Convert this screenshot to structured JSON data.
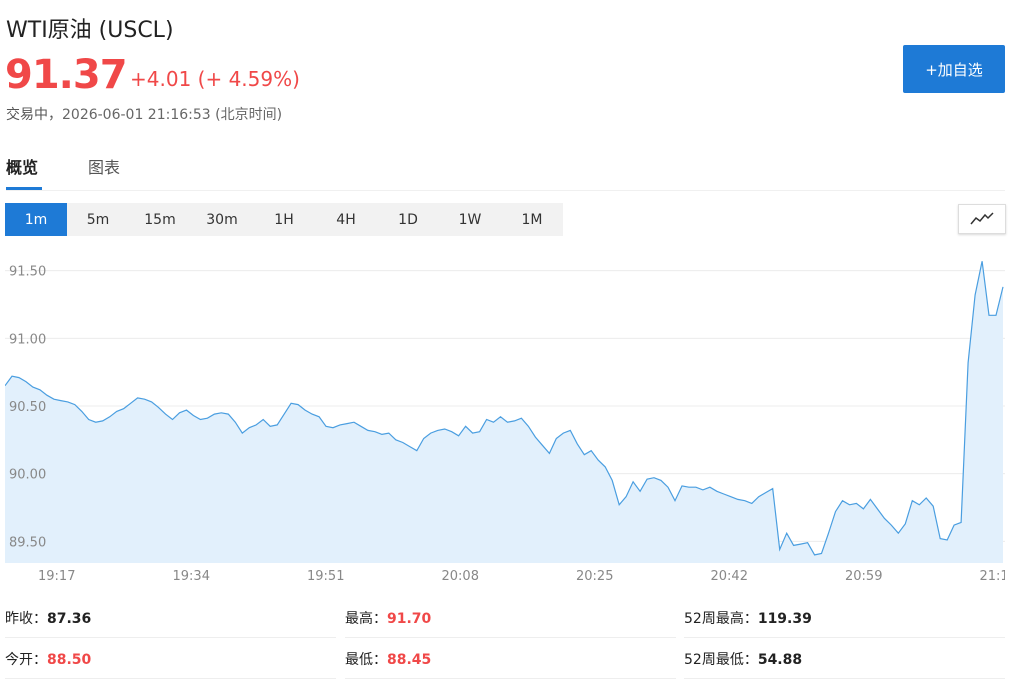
{
  "header": {
    "title": "WTI原油 (USCL)",
    "price": "91.37",
    "change": "+4.01 (+ 4.59%)",
    "status": "交易中，",
    "timestamp": "2026-06-01 21:16:53 (北京时间)",
    "add_button": "+加自选"
  },
  "tabs": [
    {
      "label": "概览",
      "active": true
    },
    {
      "label": "图表",
      "active": false
    }
  ],
  "intervals": [
    {
      "label": "1m",
      "active": true
    },
    {
      "label": "5m",
      "active": false
    },
    {
      "label": "15m",
      "active": false
    },
    {
      "label": "30m",
      "active": false
    },
    {
      "label": "1H",
      "active": false
    },
    {
      "label": "4H",
      "active": false
    },
    {
      "label": "1D",
      "active": false
    },
    {
      "label": "1W",
      "active": false
    },
    {
      "label": "1M",
      "active": false
    }
  ],
  "chart_toggle_icon": "line-chart-icon",
  "colors": {
    "accent": "#1e7ad6",
    "up": "#f04848",
    "line": "#4a9ee0",
    "fill": "#e2f0fc"
  },
  "chart_data": {
    "type": "area",
    "y_ticks": [
      "91.50",
      "91.00",
      "90.50",
      "90.00",
      "89.50"
    ],
    "x_ticks": [
      "19:17",
      "19:34",
      "19:51",
      "20:08",
      "20:25",
      "20:42",
      "20:59",
      "21:1"
    ],
    "ylim": [
      89.34,
      91.66
    ],
    "values": [
      90.65,
      90.72,
      90.71,
      90.68,
      90.64,
      90.62,
      90.58,
      90.55,
      90.54,
      90.53,
      90.51,
      90.46,
      90.4,
      90.38,
      90.39,
      90.42,
      90.46,
      90.48,
      90.52,
      90.56,
      90.55,
      90.53,
      90.49,
      90.44,
      90.4,
      90.45,
      90.47,
      90.43,
      90.4,
      90.41,
      90.44,
      90.45,
      90.44,
      90.38,
      90.3,
      90.34,
      90.36,
      90.4,
      90.35,
      90.36,
      90.44,
      90.52,
      90.51,
      90.47,
      90.44,
      90.42,
      90.35,
      90.34,
      90.36,
      90.37,
      90.38,
      90.35,
      90.32,
      90.31,
      90.29,
      90.3,
      90.25,
      90.23,
      90.2,
      90.17,
      90.26,
      90.3,
      90.32,
      90.33,
      90.31,
      90.28,
      90.35,
      90.3,
      90.31,
      90.4,
      90.38,
      90.42,
      90.38,
      90.39,
      90.41,
      90.35,
      90.27,
      90.21,
      90.15,
      90.26,
      90.3,
      90.32,
      90.22,
      90.14,
      90.17,
      90.1,
      90.05,
      89.95,
      89.77,
      89.83,
      89.94,
      89.87,
      89.96,
      89.97,
      89.95,
      89.9,
      89.8,
      89.91,
      89.9,
      89.9,
      89.88,
      89.9,
      89.87,
      89.85,
      89.83,
      89.81,
      89.8,
      89.78,
      89.83,
      89.86,
      89.89,
      89.44,
      89.56,
      89.47,
      89.48,
      89.49,
      89.4,
      89.41,
      89.56,
      89.72,
      89.8,
      89.77,
      89.78,
      89.74,
      89.81,
      89.74,
      89.67,
      89.62,
      89.56,
      89.63,
      89.8,
      89.77,
      89.82,
      89.76,
      89.52,
      89.51,
      89.62,
      89.64,
      90.82,
      91.32,
      91.57,
      91.17,
      91.17,
      91.38
    ]
  },
  "stats": [
    [
      {
        "label": "昨收：",
        "value": "87.36",
        "red": false
      },
      {
        "label": "最高：",
        "value": "91.70",
        "red": true
      },
      {
        "label": "52周最高：",
        "value": "119.39",
        "red": false
      }
    ],
    [
      {
        "label": "今开：",
        "value": "88.50",
        "red": true
      },
      {
        "label": "最低：",
        "value": "88.45",
        "red": true
      },
      {
        "label": "52周最低：",
        "value": "54.88",
        "red": false
      }
    ]
  ]
}
